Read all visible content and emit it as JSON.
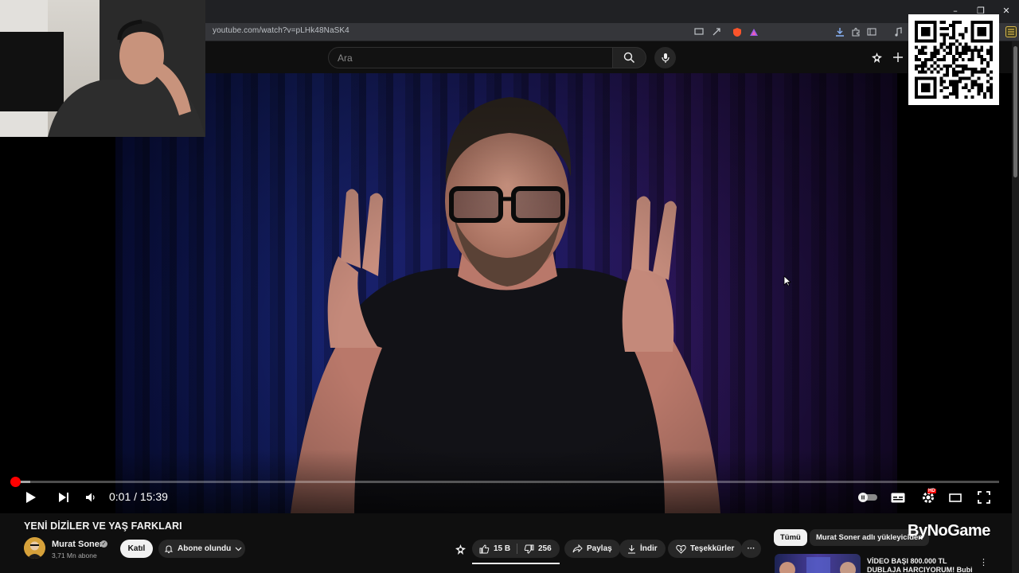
{
  "browser": {
    "url": "youtube.com/watch?v=pLHk48NaSK4",
    "window_controls": [
      "–",
      "❐",
      "✕"
    ]
  },
  "header": {
    "search_placeholder": "Ara"
  },
  "player": {
    "current_time": "0:01",
    "separator": " / ",
    "duration": "15:39",
    "time_display": "0:01 / 15:39",
    "quality_badge": "HD",
    "progress_fraction": 0.001,
    "buffered_fraction": 0.02
  },
  "video": {
    "title": "YENİ DİZİLER VE YAŞ FARKLARI",
    "channel_name": "Murat Soner",
    "subscribers": "3,71 Mn abone",
    "join_label": "Katıl",
    "subscribed_label": "Abone olundu",
    "like_count": "15 B",
    "dislike_count": "256",
    "share_label": "Paylaş",
    "download_label": "İndir",
    "thanks_label": "Teşekkürler",
    "more_label": "···"
  },
  "sidebar": {
    "chips": [
      "Tümü",
      "Murat Soner adlı yükleyiciden"
    ],
    "first_video_title": "VİDEO BAŞI 800.000 TL DUBLAJA HARCIYORUM! Bubi"
  },
  "overlay": {
    "watermark": "ByNoGame"
  },
  "colors": {
    "accent_red": "#ff0000",
    "page_bg": "#0f0f0f",
    "chip_bg": "#272727"
  }
}
